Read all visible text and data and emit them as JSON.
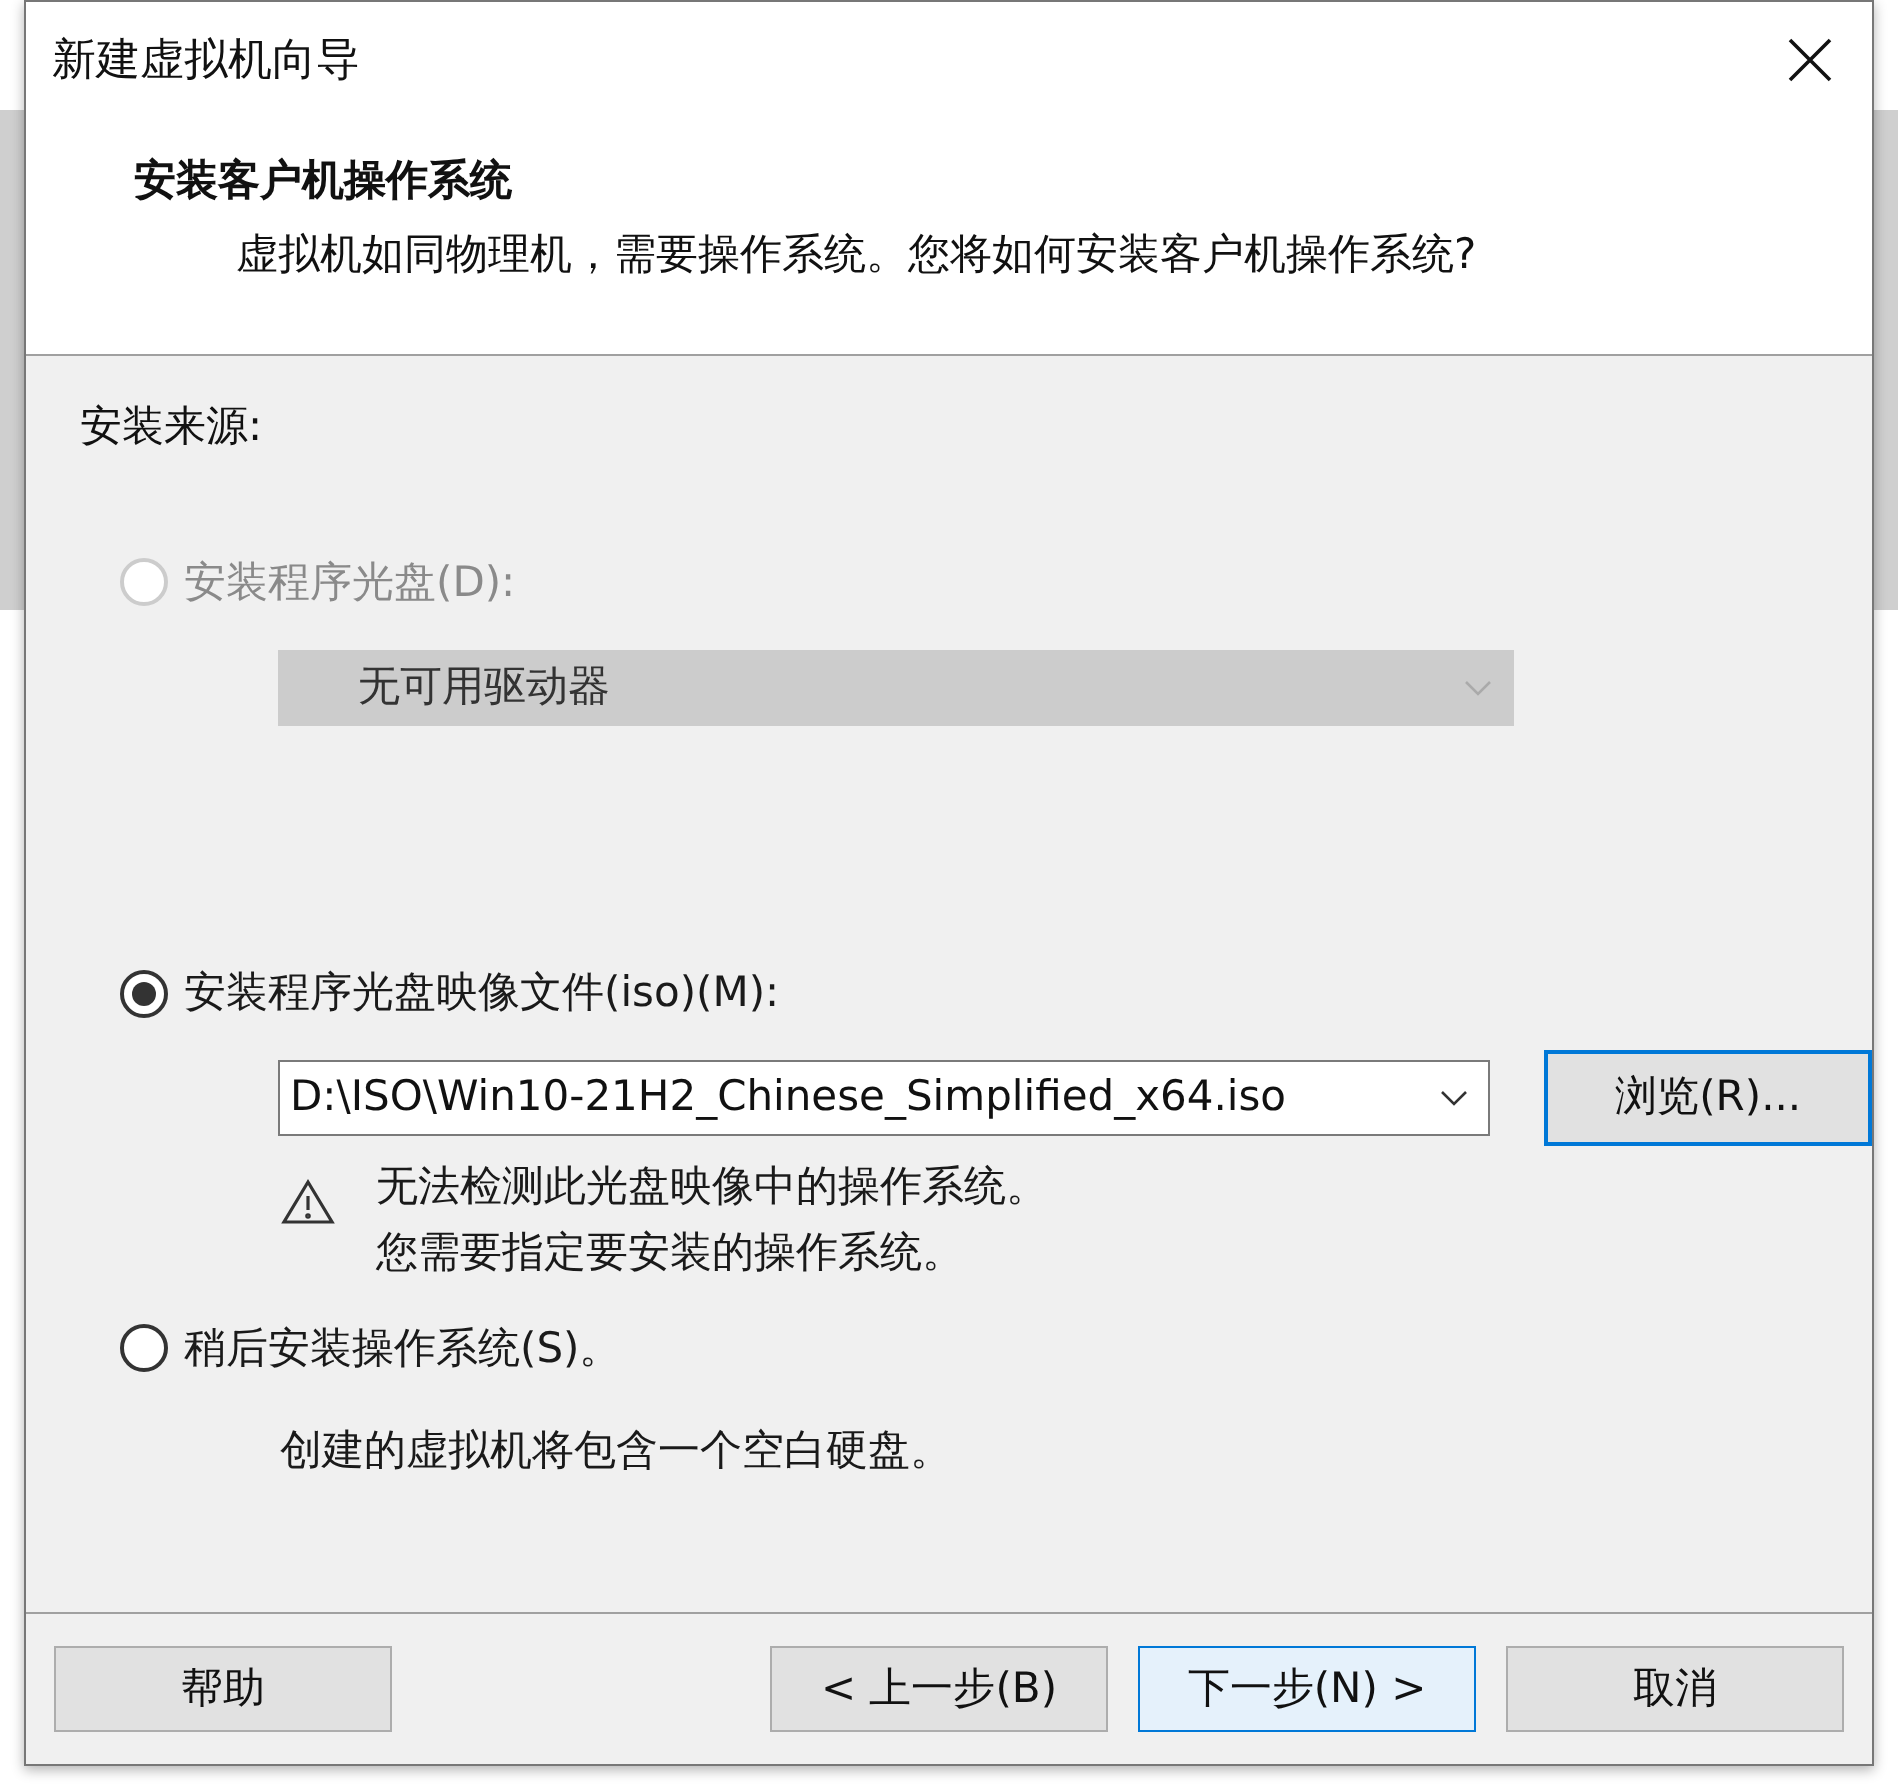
{
  "window": {
    "title": "新建虚拟机向导"
  },
  "header": {
    "title": "安装客户机操作系统",
    "subtitle": "虚拟机如同物理机，需要操作系统。您将如何安装客户机操作系统?"
  },
  "source_label": "安装来源:",
  "options": [
    {
      "kind": "disc",
      "label": "安装程序光盘(D):",
      "selected": false,
      "disabled": true,
      "dropdown": {
        "value": "无可用驱动器",
        "disabled": true
      }
    },
    {
      "kind": "iso",
      "label": "安装程序光盘映像文件(iso)(M):",
      "selected": true,
      "disabled": false,
      "dropdown": {
        "value": "D:\\ISO\\Win10-21H2_Chinese_Simplified_x64.iso",
        "disabled": false
      },
      "browse_button": "浏览(R)...",
      "warning": [
        "无法检测此光盘映像中的操作系统。",
        "您需要指定要安装的操作系统。"
      ]
    },
    {
      "kind": "later",
      "label": "稍后安装操作系统(S)。",
      "selected": false,
      "disabled": false,
      "note": "创建的虚拟机将包含一个空白硬盘。"
    }
  ],
  "buttons": [
    {
      "label": "帮助",
      "focused": false
    },
    {
      "label": "< 上一步(B)",
      "focused": false
    },
    {
      "label": "下一步(N) >",
      "focused": true
    },
    {
      "label": "取消",
      "focused": false
    }
  ]
}
